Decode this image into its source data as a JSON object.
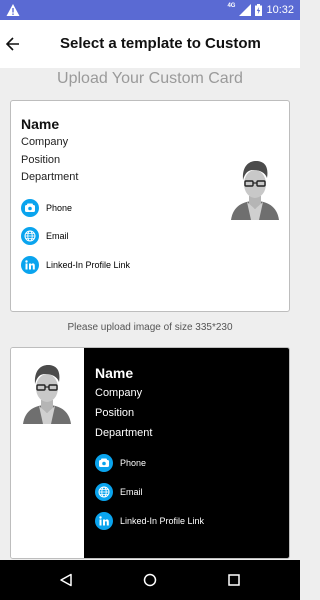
{
  "status_bar": {
    "network": "4G",
    "time": "10:32",
    "colors": {
      "background": "#5a6ad3"
    }
  },
  "app_bar": {
    "title": "Select a template to Custom"
  },
  "upload_title": "Upload Your Custom Card",
  "template_1": {
    "name": "Name",
    "company": "Company",
    "position": "Position",
    "department": "Department",
    "contacts": [
      {
        "icon": "phone-icon",
        "label": "Phone"
      },
      {
        "icon": "globe-icon",
        "label": "Email"
      },
      {
        "icon": "linkedin-icon",
        "label": "Linked-In Profile Link"
      }
    ]
  },
  "upload_note": "Please upload image of size 335*230",
  "template_2": {
    "name": "Name",
    "company": "Company",
    "position": "Position",
    "department": "Department",
    "contacts": [
      {
        "icon": "phone-icon",
        "label": "Phone"
      },
      {
        "icon": "globe-icon",
        "label": "Email"
      },
      {
        "icon": "linkedin-icon",
        "label": "Linked-In Profile Link"
      }
    ]
  },
  "colors": {
    "accent": "#0aa4ee",
    "card_dark": "#000000"
  }
}
